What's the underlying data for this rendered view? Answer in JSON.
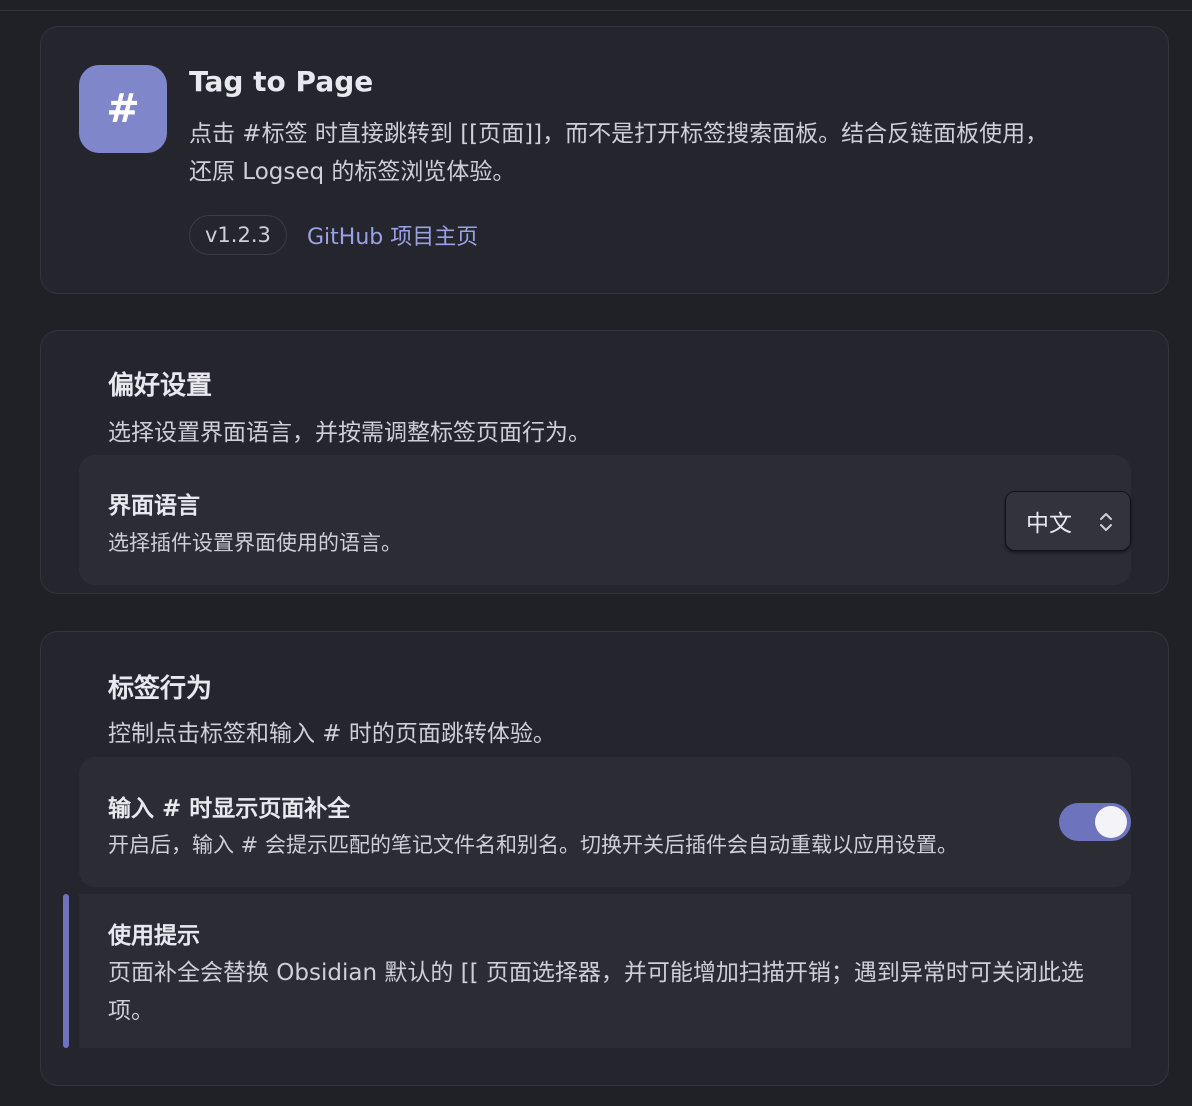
{
  "header": {
    "logo_glyph": "#",
    "title": "Tag to Page",
    "description": "点击 #标签 时直接跳转到 [[页面]]，而不是打开标签搜索面板。结合反链面板使用，还原 Logseq 的标签浏览体验。",
    "version": "v1.2.3",
    "github_link": "GitHub 项目主页"
  },
  "preferences": {
    "title": "偏好设置",
    "description": "选择设置界面语言，并按需调整标签页面行为。",
    "language": {
      "name": "界面语言",
      "description": "选择插件设置界面使用的语言。",
      "selected": "中文"
    }
  },
  "tag_behavior": {
    "title": "标签行为",
    "description": "控制点击标签和输入 # 时的页面跳转体验。",
    "completion": {
      "name": "输入 # 时显示页面补全",
      "description": "开启后，输入 # 会提示匹配的笔记文件名和别名。切换开关后插件会自动重载以应用设置。",
      "enabled": true
    },
    "tip": {
      "title": "使用提示",
      "text": "页面补全会替换 Obsidian 默认的 [[ 页面选择器，并可能增加扫描开销；遇到异常时可关闭此选项。"
    }
  },
  "colors": {
    "accent": "#6e73bd",
    "logo_bg": "#7f86c9",
    "link": "#9ba2e4"
  }
}
